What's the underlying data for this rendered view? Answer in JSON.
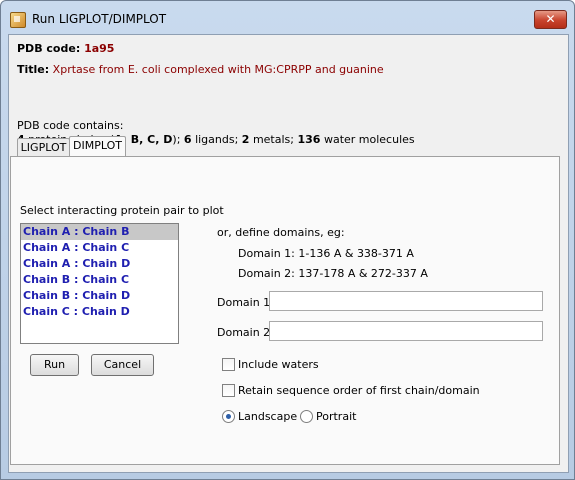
{
  "window": {
    "title": "Run LIGPLOT/DIMPLOT",
    "close_symbol": "✕"
  },
  "header": {
    "pdb_code_label": "PDB code:",
    "pdb_code": "1a95",
    "title_label": "Title:",
    "title": "Xprtase from E. coli complexed with MG:CPRPP and guanine"
  },
  "contents": {
    "heading": "PDB code contains:",
    "chains_count": "4",
    "chains_text_pre": "protein chains (",
    "chains_list": "A, B, C, D",
    "chains_text_post": ");",
    "ligands_count": "6",
    "ligands_text": "ligands;",
    "metals_count": "2",
    "metals_text": "metals;",
    "water_count": "136",
    "water_text": "water molecules"
  },
  "tabs": [
    {
      "label": "LIGPLOT",
      "active": false
    },
    {
      "label": "DIMPLOT",
      "active": true
    }
  ],
  "dimplot": {
    "select_label": "Select interacting protein pair to plot",
    "pairs": [
      "Chain A : Chain B",
      "Chain A : Chain C",
      "Chain A : Chain D",
      "Chain B : Chain C",
      "Chain B : Chain D",
      "Chain C : Chain D"
    ],
    "selected_pair_index": 0,
    "define_label": "or, define domains, eg:",
    "example1": "Domain 1: 1-136 A & 338-371 A",
    "example2": "Domain 2: 137-178 A & 272-337 A",
    "domain1_label": "Domain 1:",
    "domain1_value": "",
    "domain2_label": "Domain 2:",
    "domain2_value": "",
    "include_waters_label": "Include waters",
    "include_waters_checked": false,
    "retain_order_label": "Retain sequence order of first chain/domain",
    "retain_order_checked": false,
    "orientation_landscape": "Landscape",
    "orientation_portrait": "Portrait",
    "orientation_selected": "Landscape",
    "run_label": "Run",
    "cancel_label": "Cancel"
  }
}
